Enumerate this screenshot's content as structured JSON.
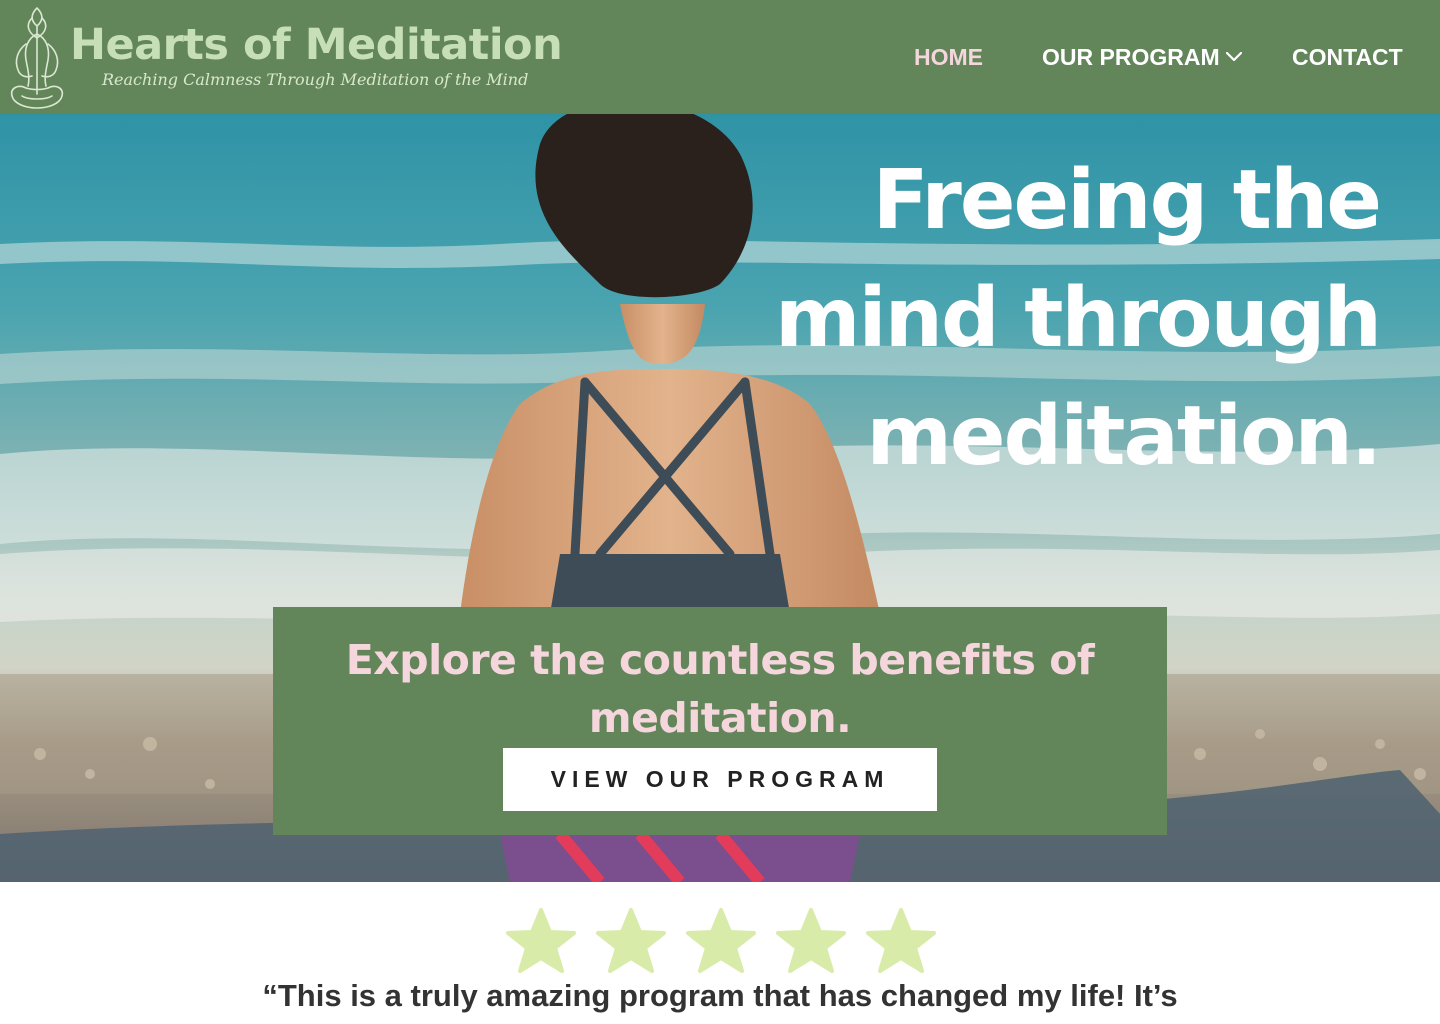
{
  "brand": {
    "title": "Hearts of Meditation",
    "tagline": "Reaching Calmness Through Meditation of the Mind",
    "logo_icon": "meditating-figure-icon"
  },
  "nav": {
    "items": [
      {
        "label": "HOME",
        "active": true
      },
      {
        "label": "OUR PROGRAM",
        "has_dropdown": true,
        "icon": "chevron-down-icon"
      },
      {
        "label": "CONTACT"
      }
    ]
  },
  "hero": {
    "headline": [
      "Freeing the",
      "mind through",
      "meditation."
    ],
    "cta_text": "Explore the countless benefits of meditation.",
    "cta_button_label": "VIEW OUR PROGRAM"
  },
  "testimonial": {
    "rating": 5,
    "rating_max": 5,
    "star_icon": "star-icon",
    "quote": "“This is a truly amazing program that has changed my life!  It’s"
  },
  "colors": {
    "header_bg": "#62855a",
    "active_nav": "#f4d6dc",
    "cta_text": "#f4d6dc",
    "logo_text": "#c7dfb8",
    "star": "#d8eba9"
  }
}
